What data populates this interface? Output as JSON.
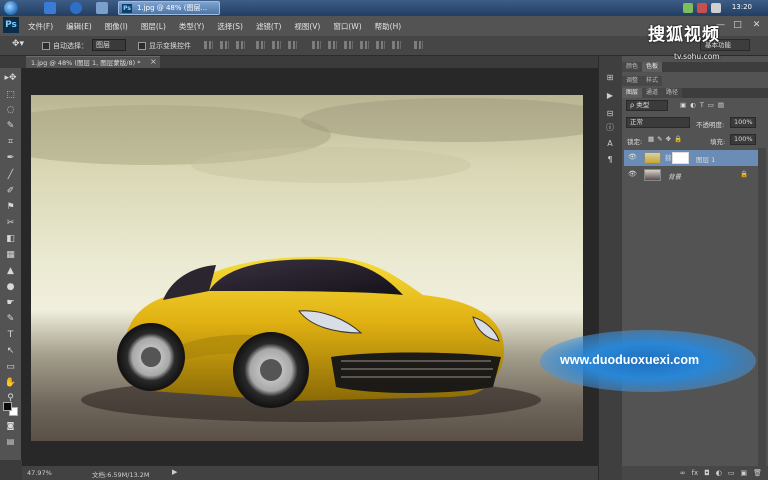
{
  "taskbar": {
    "active_task": "1.jpg @ 48% (图层...",
    "task_icon_text": "Ps",
    "clock": "13:20"
  },
  "app": {
    "logo": "Ps"
  },
  "menu": [
    "文件(F)",
    "编辑(E)",
    "图像(I)",
    "图层(L)",
    "类型(Y)",
    "选择(S)",
    "滤镜(T)",
    "视图(V)",
    "窗口(W)",
    "帮助(H)"
  ],
  "window_controls": {
    "minimize": "—",
    "maximize": "□",
    "close": "✕"
  },
  "options_bar": {
    "auto_select_label": "自动选择：",
    "auto_select_value": "图层",
    "show_transform_label": "显示变换控件"
  },
  "workspace": {
    "essentials": "基本功能"
  },
  "document": {
    "tab_title": "1.jpg @ 48% (图层 1, 图层蒙版/8) *",
    "close_glyph": "×"
  },
  "status": {
    "zoom": "47.97%",
    "doc_size": "文档:6.59M/13.2M",
    "arrow": "▶"
  },
  "panels": {
    "tabs_top": [
      "颜色",
      "色板"
    ],
    "tabs_mid": [
      "调整",
      "样式"
    ],
    "tabs_layers": [
      "图层",
      "通道",
      "路径"
    ],
    "filter_label": "ρ 类型",
    "blend_mode": "正常",
    "opacity_label": "不透明度:",
    "opacity_value": "100%",
    "lock_label": "锁定:",
    "fill_label": "填充:",
    "fill_value": "100%",
    "layers": [
      {
        "name": "图层 1",
        "selected": true
      },
      {
        "name": "背景",
        "selected": false
      }
    ],
    "footer_icons": [
      "∞",
      "fx",
      "◘",
      "◐",
      "▭",
      "▣",
      "🗑"
    ]
  },
  "tools": [
    "▸✥",
    "⬚",
    "◌",
    "✎",
    "⌗",
    "✒",
    "╱",
    "✐",
    "⚑",
    "✂",
    "◧",
    "▦",
    "▲",
    "●",
    "☛",
    "✎",
    "T",
    "↖",
    "▭",
    "✋",
    "⚲"
  ],
  "watermarks": {
    "sohu": "搜狐视频",
    "sohu_url": "tv.sohu.com",
    "duoduo": "www.duoduoxuexi.com"
  },
  "colors": {
    "accent": "#2a86d6",
    "ps_bg": "#535353",
    "selected_layer": "#6b8db5"
  }
}
